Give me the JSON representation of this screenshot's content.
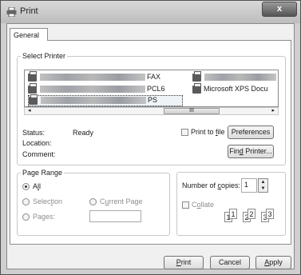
{
  "window": {
    "title": "Print",
    "close_label": "x"
  },
  "tabs": [
    {
      "label": "General"
    }
  ],
  "select_printer": {
    "legend": "Select Printer",
    "printers": [
      {
        "label": "FAX"
      },
      {
        "label": "PCL6"
      },
      {
        "label": "PS",
        "selected": true
      },
      {
        "label": "Microsoft XPS Docu"
      }
    ],
    "scroll_left": "◂",
    "scroll_right": "▸",
    "scroll_thumb": "III"
  },
  "status": {
    "status_label": "Status:",
    "status_value": "Ready",
    "location_label": "Location:",
    "comment_label": "Comment:"
  },
  "print_to_file": {
    "before": "Print to ",
    "underlined": "f",
    "after": "ile",
    "checked": false
  },
  "buttons": {
    "preferences": "Preferences",
    "find_before": "Fin",
    "find_u": "d",
    "find_after": " Printer...",
    "print_u": "P",
    "print_after": "rint",
    "cancel": "Cancel",
    "apply_u": "A",
    "apply_after": "pply"
  },
  "page_range": {
    "legend": "Page Range",
    "all_before": "A",
    "all_u": "l",
    "all_after": "l",
    "selection_before": "Selec",
    "selection_u": "t",
    "selection_after": "ion",
    "current_before": "C",
    "current_u": "u",
    "current_after": "rrent Page",
    "pages_before": "Pa",
    "pages_u": "g",
    "pages_after": "es:",
    "pages_value": ""
  },
  "copies": {
    "label_before": "Number of ",
    "label_u": "c",
    "label_after": "opies:",
    "value": "1",
    "collate_before": "C",
    "collate_u": "o",
    "collate_after": "llate",
    "collate_checked": false,
    "page_nums": [
      "1",
      "1",
      "2",
      "2",
      "3",
      "3"
    ]
  }
}
